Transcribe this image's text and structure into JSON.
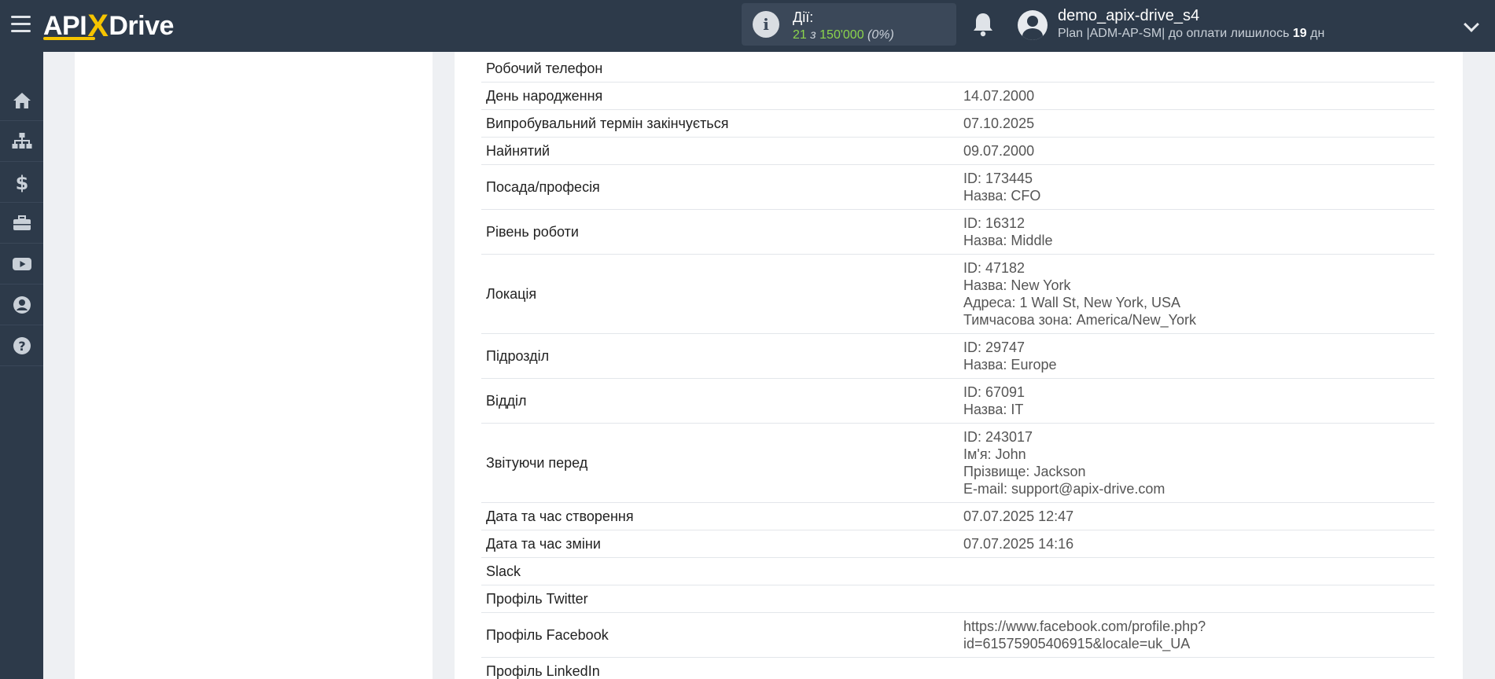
{
  "header": {
    "logo": {
      "part1": "API",
      "part2": "X",
      "part3": "Drive"
    },
    "actions": {
      "label": "Дії:",
      "count": "21",
      "of": "з",
      "limit": "150'000",
      "percent": "(0%)"
    },
    "user": {
      "name": "demo_apix-drive_s4",
      "plan_prefix": "Plan |ADM-AP-SM| до оплати лишилось",
      "days": "19",
      "days_suffix": "дн"
    }
  },
  "sidebar": {
    "items": [
      {
        "name": "home-icon"
      },
      {
        "name": "sitemap-icon"
      },
      {
        "name": "dollar-icon"
      },
      {
        "name": "briefcase-icon"
      },
      {
        "name": "youtube-icon"
      },
      {
        "name": "user-circle-icon"
      },
      {
        "name": "help-icon"
      }
    ]
  },
  "fields": [
    {
      "key": "Робочий телефон",
      "values": []
    },
    {
      "key": "День народження",
      "values": [
        "14.07.2000"
      ]
    },
    {
      "key": "Випробувальний термін закінчується",
      "values": [
        "07.10.2025"
      ]
    },
    {
      "key": "Найнятий",
      "values": [
        "09.07.2000"
      ]
    },
    {
      "key": "Посада/професія",
      "values": [
        "ID: 173445",
        "Назва: CFO"
      ]
    },
    {
      "key": "Рівень роботи",
      "values": [
        "ID: 16312",
        "Назва: Middle"
      ]
    },
    {
      "key": "Локація",
      "values": [
        "ID: 47182",
        "Назва: New York",
        "Адреса: 1 Wall St, New York, USA",
        "Тимчасова зона: America/New_York"
      ]
    },
    {
      "key": "Підрозділ",
      "values": [
        "ID: 29747",
        "Назва: Europe"
      ]
    },
    {
      "key": "Відділ",
      "values": [
        "ID: 67091",
        "Назва: IT"
      ]
    },
    {
      "key": "Звітуючи перед",
      "values": [
        "ID: 243017",
        "Ім'я: John",
        "Прізвище: Jackson",
        "E-mail: support@apix-drive.com"
      ]
    },
    {
      "key": "Дата та час створення",
      "values": [
        "07.07.2025 12:47"
      ]
    },
    {
      "key": "Дата та час зміни",
      "values": [
        "07.07.2025 14:16"
      ]
    },
    {
      "key": "Slack",
      "values": []
    },
    {
      "key": "Профіль Twitter",
      "values": []
    },
    {
      "key": "Профіль Facebook",
      "values": [
        "https://www.facebook.com/profile.php?",
        "id=61575905406915&locale=uk_UA"
      ]
    },
    {
      "key": "Профіль LinkedIn",
      "values": []
    }
  ]
}
